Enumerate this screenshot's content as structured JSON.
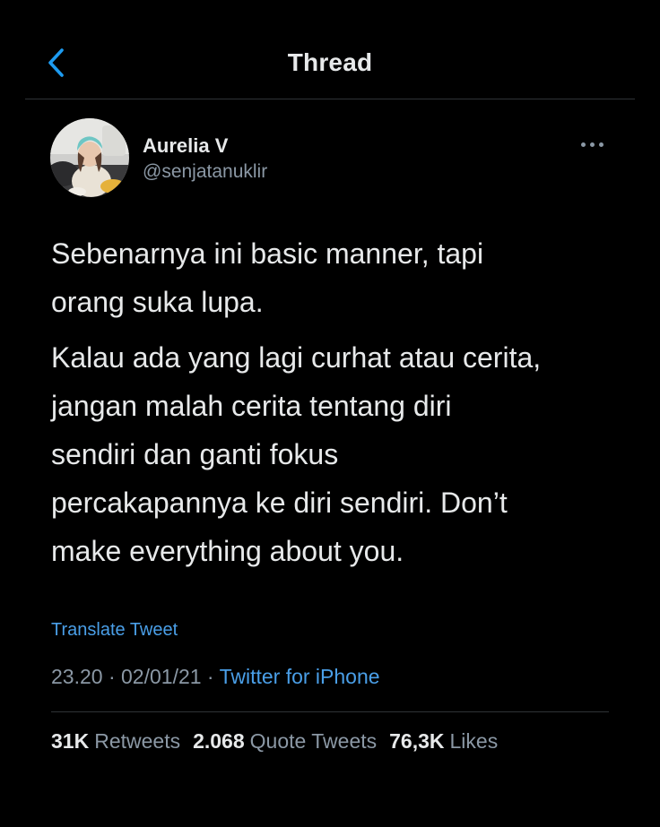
{
  "header": {
    "title": "Thread",
    "back_icon": "chevron-left-icon",
    "accent_color": "#1d9bf0"
  },
  "author": {
    "display_name": "Aurelia V",
    "handle": "@senjatanuklir",
    "more_icon": "more-horizontal-icon"
  },
  "tweet": {
    "paragraph_1_line_1": "Sebenarnya ini basic manner, tapi",
    "paragraph_1_line_2": "orang suka lupa.",
    "paragraph_2_line_1": "Kalau ada yang lagi curhat atau cerita,",
    "paragraph_2_line_2": "jangan malah cerita tentang diri",
    "paragraph_2_line_3": "sendiri dan ganti fokus",
    "paragraph_2_line_4": "percakapannya ke diri sendiri. Don’t",
    "paragraph_2_line_5": "make everything about you.",
    "translate_label": "Translate Tweet"
  },
  "meta": {
    "time": "23.20",
    "separator": " · ",
    "date": "02/01/21",
    "source": "Twitter for iPhone"
  },
  "stats": {
    "retweets_count": "31K",
    "retweets_label": "Retweets",
    "quotes_count": "2.068",
    "quotes_label": "Quote Tweets",
    "likes_count": "76,3K",
    "likes_label": "Likes"
  }
}
